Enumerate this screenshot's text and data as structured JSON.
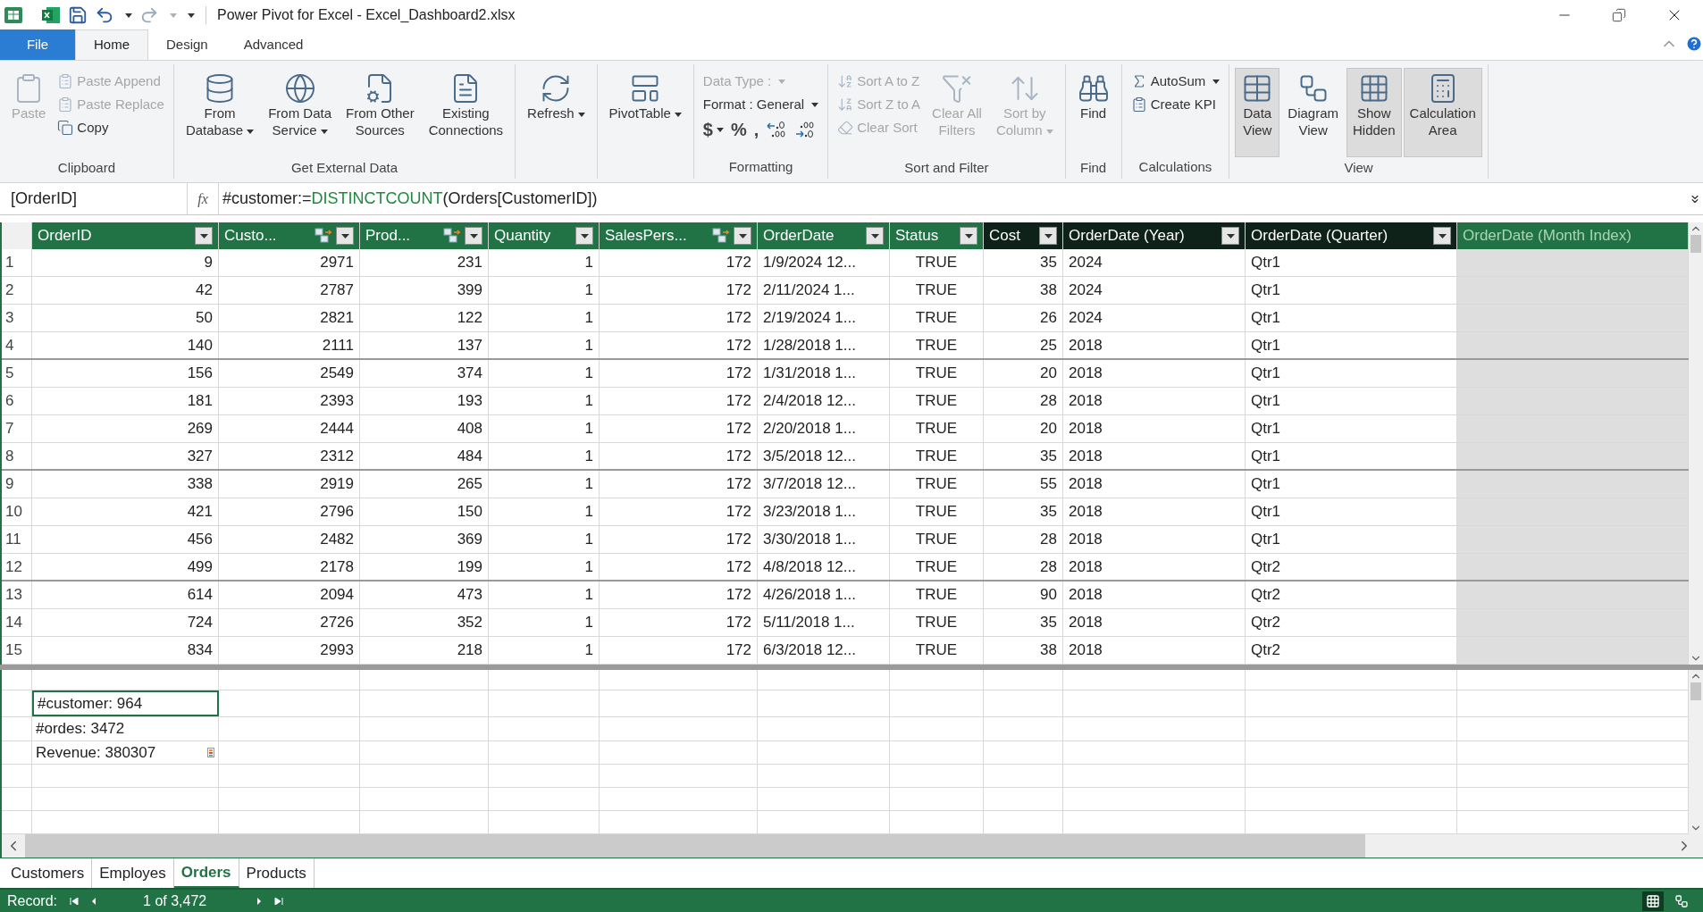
{
  "window": {
    "title": "Power Pivot for Excel - Excel_Dashboard2.xlsx"
  },
  "ribbon_tabs": [
    {
      "label": "File",
      "selected": false,
      "kind": "file"
    },
    {
      "label": "Home",
      "selected": true,
      "kind": "tab"
    },
    {
      "label": "Design",
      "selected": false,
      "kind": "tab"
    },
    {
      "label": "Advanced",
      "selected": false,
      "kind": "tab"
    }
  ],
  "ribbon_groups": [
    {
      "label": "Clipboard",
      "items": [
        {
          "kind": "large",
          "lines": [
            "Paste"
          ],
          "dropdown": false,
          "disabled": true
        },
        {
          "kind": "small",
          "label": "Paste Append",
          "dropdown": false,
          "disabled": true
        },
        {
          "kind": "small",
          "label": "Paste Replace",
          "dropdown": false,
          "disabled": true
        },
        {
          "kind": "small",
          "label": "Copy",
          "dropdown": false,
          "disabled": false
        }
      ]
    },
    {
      "label": "Get External Data",
      "items": [
        {
          "kind": "large",
          "lines": [
            "From",
            "Database"
          ],
          "dropdown": true,
          "disabled": false
        },
        {
          "kind": "large",
          "lines": [
            "From Data",
            "Service"
          ],
          "dropdown": true,
          "disabled": false
        },
        {
          "kind": "large",
          "lines": [
            "From Other",
            "Sources"
          ],
          "dropdown": false,
          "disabled": false
        },
        {
          "kind": "large",
          "lines": [
            "Existing",
            "Connections"
          ],
          "dropdown": false,
          "disabled": false
        }
      ]
    },
    {
      "items": [
        {
          "kind": "large",
          "lines": [
            "Refresh"
          ],
          "dropdown": true,
          "disabled": false
        }
      ]
    },
    {
      "items": [
        {
          "kind": "large",
          "lines": [
            "PivotTable"
          ],
          "dropdown": true,
          "disabled": false
        }
      ]
    },
    {
      "label": "Formatting",
      "items": [
        {
          "kind": "small",
          "label": "Data Type :",
          "dropdown": true,
          "disabled": true
        },
        {
          "kind": "small",
          "label": "Format : General",
          "dropdown": true,
          "disabled": false
        },
        {
          "kind": "symbols",
          "symbols": [
            {
              "text": "$",
              "dropdown": true
            },
            {
              "text": "%",
              "dropdown": false
            },
            {
              "text": ",",
              "dropdown": false
            }
          ]
        }
      ]
    },
    {
      "label": "Sort and Filter",
      "items": [
        {
          "kind": "small",
          "label": "Sort A to Z",
          "dropdown": false,
          "disabled": true
        },
        {
          "kind": "small",
          "label": "Sort Z to A",
          "dropdown": false,
          "disabled": true
        },
        {
          "kind": "small",
          "label": "Clear Sort",
          "dropdown": false,
          "disabled": true
        },
        {
          "kind": "large",
          "lines": [
            "Clear All",
            "Filters"
          ],
          "dropdown": false,
          "disabled": true
        },
        {
          "kind": "large",
          "lines": [
            "Sort by",
            "Column"
          ],
          "dropdown": true,
          "disabled": true
        }
      ]
    },
    {
      "label": "Find",
      "items": [
        {
          "kind": "large",
          "lines": [
            "Find"
          ],
          "dropdown": false,
          "disabled": false
        }
      ]
    },
    {
      "label": "Calculations",
      "items": [
        {
          "kind": "small",
          "label": "AutoSum",
          "dropdown": true,
          "disabled": false
        },
        {
          "kind": "small",
          "label": "Create KPI",
          "dropdown": false,
          "disabled": false
        }
      ]
    },
    {
      "label": "View",
      "items": [
        {
          "kind": "large",
          "lines": [
            "Data",
            "View"
          ],
          "dropdown": false,
          "disabled": false,
          "selected": true
        },
        {
          "kind": "large",
          "lines": [
            "Diagram",
            "View"
          ],
          "dropdown": false,
          "disabled": false,
          "selected": false
        },
        {
          "kind": "large",
          "lines": [
            "Show",
            "Hidden"
          ],
          "dropdown": false,
          "disabled": false,
          "selected": true
        },
        {
          "kind": "large",
          "lines": [
            "Calculation",
            "Area"
          ],
          "dropdown": false,
          "disabled": false,
          "selected": true
        }
      ]
    }
  ],
  "formula_bar": {
    "name_box": "[OrderID]",
    "fx": "fx",
    "formula": [
      {
        "text": "#customer:=",
        "kind": "plain"
      },
      {
        "text": "DISTINCTCOUNT",
        "kind": "function"
      },
      {
        "text": "(Orders[CustomerID])",
        "kind": "plain"
      }
    ]
  },
  "table": {
    "columns": [
      {
        "label": "OrderID",
        "kind": "data",
        "related": false
      },
      {
        "label": "Custo...",
        "kind": "data",
        "related": true
      },
      {
        "label": "Prod...",
        "kind": "data",
        "related": true
      },
      {
        "label": "Quantity",
        "kind": "data",
        "related": false
      },
      {
        "label": "SalesPers...",
        "kind": "data",
        "related": true
      },
      {
        "label": "OrderDate",
        "kind": "data",
        "related": false
      },
      {
        "label": "Status",
        "kind": "data",
        "related": false
      },
      {
        "label": "Cost",
        "kind": "calculated",
        "related": false
      },
      {
        "label": "OrderDate (Year)",
        "kind": "calculated",
        "related": false
      },
      {
        "label": "OrderDate (Quarter)",
        "kind": "calculated",
        "related": false
      },
      {
        "label": "OrderDate (Month Index)",
        "kind": "pending",
        "related": false
      }
    ],
    "rows": [
      {
        "number": "1",
        "cells": [
          "9",
          "2971",
          "231",
          "1",
          "172",
          "1/9/2024 12...",
          "TRUE",
          "35",
          "2024",
          "Qtr1"
        ]
      },
      {
        "number": "2",
        "cells": [
          "42",
          "2787",
          "399",
          "1",
          "172",
          "2/11/2024 1...",
          "TRUE",
          "38",
          "2024",
          "Qtr1"
        ]
      },
      {
        "number": "3",
        "cells": [
          "50",
          "2821",
          "122",
          "1",
          "172",
          "2/19/2024 1...",
          "TRUE",
          "26",
          "2024",
          "Qtr1"
        ]
      },
      {
        "number": "4",
        "cells": [
          "140",
          "2111",
          "137",
          "1",
          "172",
          "1/28/2018 1...",
          "TRUE",
          "25",
          "2018",
          "Qtr1"
        ]
      },
      {
        "number": "5",
        "cells": [
          "156",
          "2549",
          "374",
          "1",
          "172",
          "1/31/2018 1...",
          "TRUE",
          "20",
          "2018",
          "Qtr1"
        ]
      },
      {
        "number": "6",
        "cells": [
          "181",
          "2393",
          "193",
          "1",
          "172",
          "2/4/2018 12...",
          "TRUE",
          "28",
          "2018",
          "Qtr1"
        ]
      },
      {
        "number": "7",
        "cells": [
          "269",
          "2444",
          "408",
          "1",
          "172",
          "2/20/2018 1...",
          "TRUE",
          "20",
          "2018",
          "Qtr1"
        ]
      },
      {
        "number": "8",
        "cells": [
          "327",
          "2312",
          "484",
          "1",
          "172",
          "3/5/2018 12...",
          "TRUE",
          "35",
          "2018",
          "Qtr1"
        ]
      },
      {
        "number": "9",
        "cells": [
          "338",
          "2919",
          "265",
          "1",
          "172",
          "3/7/2018 12...",
          "TRUE",
          "55",
          "2018",
          "Qtr1"
        ]
      },
      {
        "number": "10",
        "cells": [
          "421",
          "2796",
          "150",
          "1",
          "172",
          "3/23/2018 1...",
          "TRUE",
          "35",
          "2018",
          "Qtr1"
        ]
      },
      {
        "number": "11",
        "cells": [
          "456",
          "2482",
          "369",
          "1",
          "172",
          "3/30/2018 1...",
          "TRUE",
          "28",
          "2018",
          "Qtr1"
        ]
      },
      {
        "number": "12",
        "cells": [
          "499",
          "2178",
          "199",
          "1",
          "172",
          "4/8/2018 12...",
          "TRUE",
          "28",
          "2018",
          "Qtr2"
        ]
      },
      {
        "number": "13",
        "cells": [
          "614",
          "2094",
          "473",
          "1",
          "172",
          "4/26/2018 1...",
          "TRUE",
          "90",
          "2018",
          "Qtr2"
        ]
      },
      {
        "number": "14",
        "cells": [
          "724",
          "2726",
          "352",
          "1",
          "172",
          "5/11/2018 1...",
          "TRUE",
          "35",
          "2018",
          "Qtr2"
        ]
      },
      {
        "number": "15",
        "cells": [
          "834",
          "2993",
          "218",
          "1",
          "172",
          "6/3/2018 12...",
          "TRUE",
          "38",
          "2018",
          "Qtr2"
        ]
      }
    ]
  },
  "calculation_area": {
    "measures": [
      {
        "text": "#customer: 964",
        "selected": true,
        "kpi": false
      },
      {
        "text": "#ordes: 3472",
        "selected": false,
        "kpi": false
      },
      {
        "text": "Revenue: 380307",
        "selected": false,
        "kpi": true
      }
    ]
  },
  "sheet_tabs": [
    {
      "label": "Customers",
      "selected": false
    },
    {
      "label": "Employes",
      "selected": false
    },
    {
      "label": "Orders",
      "selected": true
    },
    {
      "label": "Products",
      "selected": false
    }
  ],
  "status_bar": {
    "record_label": "Record:",
    "position": "1 of 3,472",
    "views": [
      {
        "selected": true
      },
      {
        "selected": false
      }
    ]
  }
}
